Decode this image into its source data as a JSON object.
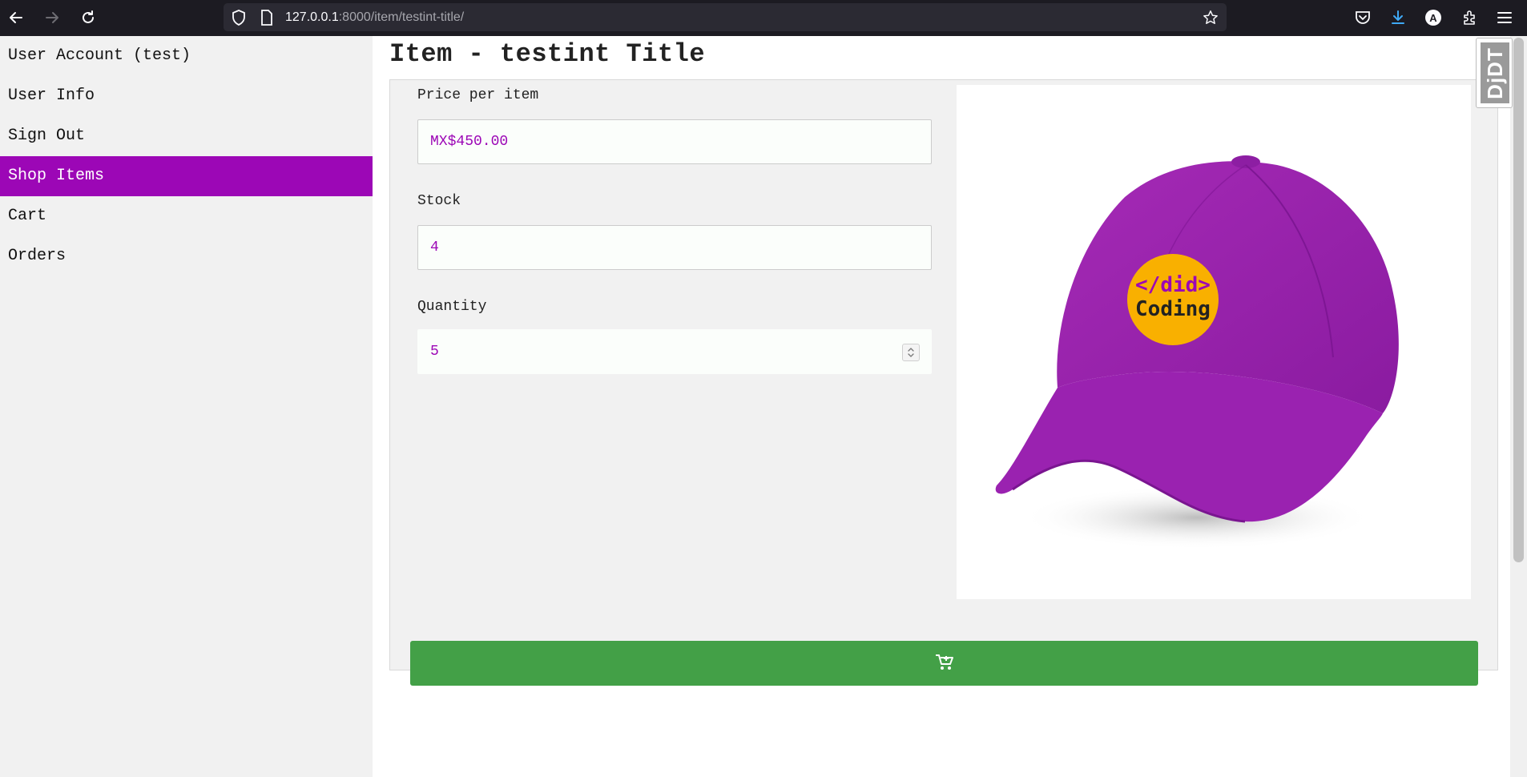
{
  "browser": {
    "url_host": "127.0.0.1",
    "url_rest": ":8000/item/testint-title/"
  },
  "sidebar": {
    "items": [
      {
        "label": "User Account (test)"
      },
      {
        "label": "User Info"
      },
      {
        "label": "Sign Out"
      },
      {
        "label": "Shop Items"
      },
      {
        "label": "Cart"
      },
      {
        "label": "Orders"
      }
    ],
    "active_index": 3
  },
  "main": {
    "title": "Item - testint Title",
    "fields": [
      {
        "label": "Price per item",
        "value": "MX$450.00"
      },
      {
        "label": "Stock",
        "value": "4"
      },
      {
        "label": "Quantity",
        "value": "5"
      }
    ],
    "image": {
      "logo_line1": "</did>",
      "logo_line2": "Coding"
    },
    "add_to_cart_icon": "cart-plus-icon"
  },
  "toolbar": {
    "djdt_label": "DjDT"
  },
  "colors": {
    "accent": "#9c07b6",
    "button": "#43a047",
    "logo_bg": "#f9b000"
  }
}
